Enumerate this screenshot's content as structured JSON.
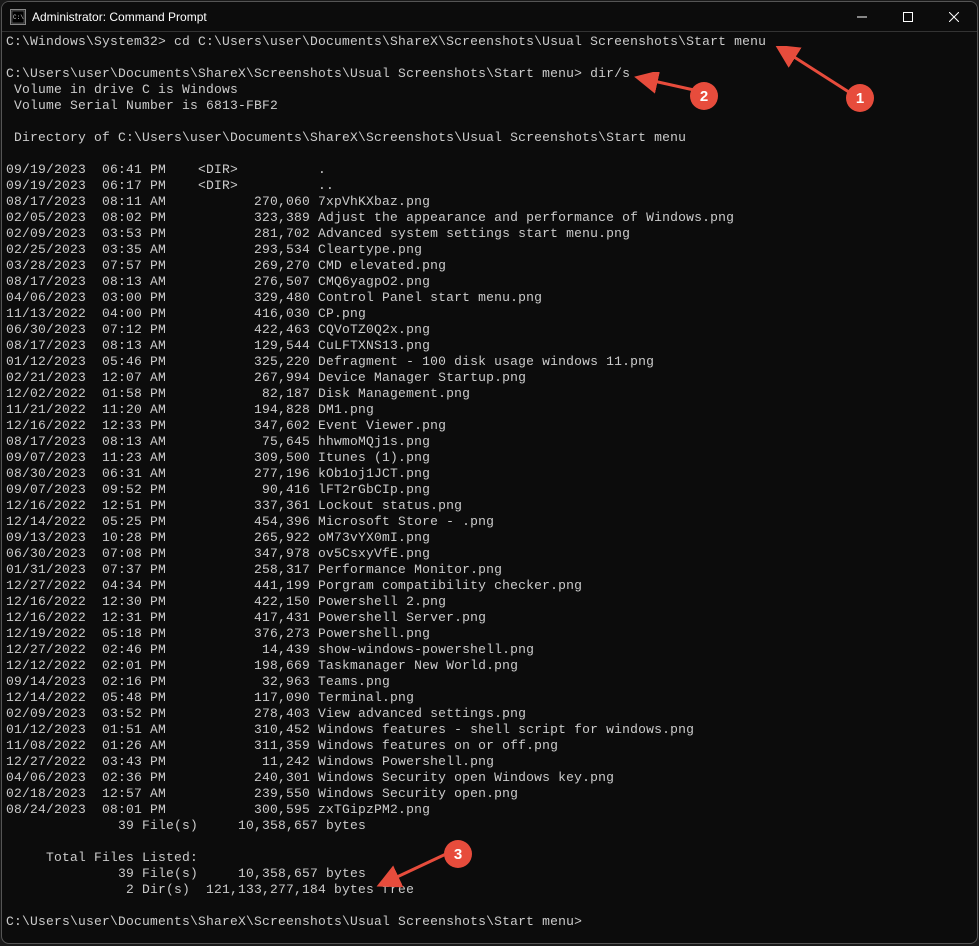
{
  "window": {
    "title": "Administrator: Command Prompt",
    "icon_glyph": "C:\\"
  },
  "prompt1": "C:\\Windows\\System32>",
  "command1": "cd C:\\Users\\user\\Documents\\ShareX\\Screenshots\\Usual Screenshots\\Start menu",
  "prompt2": "C:\\Users\\user\\Documents\\ShareX\\Screenshots\\Usual Screenshots\\Start menu>",
  "command2": "dir/s",
  "volume_line1": " Volume in drive C is Windows",
  "volume_line2": " Volume Serial Number is 6813-FBF2",
  "dir_header": " Directory of C:\\Users\\user\\Documents\\ShareX\\Screenshots\\Usual Screenshots\\Start menu",
  "entries": [
    {
      "date": "09/19/2023",
      "time": "06:41 PM",
      "size": "<DIR>         ",
      "name": "."
    },
    {
      "date": "09/19/2023",
      "time": "06:17 PM",
      "size": "<DIR>         ",
      "name": ".."
    },
    {
      "date": "08/17/2023",
      "time": "08:11 AM",
      "size": "       270,060",
      "name": "7xpVhKXbaz.png"
    },
    {
      "date": "02/05/2023",
      "time": "08:02 PM",
      "size": "       323,389",
      "name": "Adjust the appearance and performance of Windows.png"
    },
    {
      "date": "02/09/2023",
      "time": "03:53 PM",
      "size": "       281,702",
      "name": "Advanced system settings start menu.png"
    },
    {
      "date": "02/25/2023",
      "time": "03:35 AM",
      "size": "       293,534",
      "name": "Cleartype.png"
    },
    {
      "date": "03/28/2023",
      "time": "07:57 PM",
      "size": "       269,270",
      "name": "CMD elevated.png"
    },
    {
      "date": "08/17/2023",
      "time": "08:13 AM",
      "size": "       276,507",
      "name": "CMQ6yagpO2.png"
    },
    {
      "date": "04/06/2023",
      "time": "03:00 PM",
      "size": "       329,480",
      "name": "Control Panel start menu.png"
    },
    {
      "date": "11/13/2022",
      "time": "04:00 PM",
      "size": "       416,030",
      "name": "CP.png"
    },
    {
      "date": "06/30/2023",
      "time": "07:12 PM",
      "size": "       422,463",
      "name": "CQVoTZ0Q2x.png"
    },
    {
      "date": "08/17/2023",
      "time": "08:13 AM",
      "size": "       129,544",
      "name": "CuLFTXNS13.png"
    },
    {
      "date": "01/12/2023",
      "time": "05:46 PM",
      "size": "       325,220",
      "name": "Defragment - 100 disk usage windows 11.png"
    },
    {
      "date": "02/21/2023",
      "time": "12:07 AM",
      "size": "       267,994",
      "name": "Device Manager Startup.png"
    },
    {
      "date": "12/02/2022",
      "time": "01:58 PM",
      "size": "        82,187",
      "name": "Disk Management.png"
    },
    {
      "date": "11/21/2022",
      "time": "11:20 AM",
      "size": "       194,828",
      "name": "DM1.png"
    },
    {
      "date": "12/16/2022",
      "time": "12:33 PM",
      "size": "       347,602",
      "name": "Event Viewer.png"
    },
    {
      "date": "08/17/2023",
      "time": "08:13 AM",
      "size": "        75,645",
      "name": "hhwmoMQj1s.png"
    },
    {
      "date": "09/07/2023",
      "time": "11:23 AM",
      "size": "       309,500",
      "name": "Itunes (1).png"
    },
    {
      "date": "08/30/2023",
      "time": "06:31 AM",
      "size": "       277,196",
      "name": "kOb1oj1JCT.png"
    },
    {
      "date": "09/07/2023",
      "time": "09:52 PM",
      "size": "        90,416",
      "name": "lFT2rGbCIp.png"
    },
    {
      "date": "12/16/2022",
      "time": "12:51 PM",
      "size": "       337,361",
      "name": "Lockout status.png"
    },
    {
      "date": "12/14/2022",
      "time": "05:25 PM",
      "size": "       454,396",
      "name": "Microsoft Store - .png"
    },
    {
      "date": "09/13/2023",
      "time": "10:28 PM",
      "size": "       265,922",
      "name": "oM73vYX0mI.png"
    },
    {
      "date": "06/30/2023",
      "time": "07:08 PM",
      "size": "       347,978",
      "name": "ov5CsxyVfE.png"
    },
    {
      "date": "01/31/2023",
      "time": "07:37 PM",
      "size": "       258,317",
      "name": "Performance Monitor.png"
    },
    {
      "date": "12/27/2022",
      "time": "04:34 PM",
      "size": "       441,199",
      "name": "Porgram compatibility checker.png"
    },
    {
      "date": "12/16/2022",
      "time": "12:30 PM",
      "size": "       422,150",
      "name": "Powershell 2.png"
    },
    {
      "date": "12/16/2022",
      "time": "12:31 PM",
      "size": "       417,431",
      "name": "Powershell Server.png"
    },
    {
      "date": "12/19/2022",
      "time": "05:18 PM",
      "size": "       376,273",
      "name": "Powershell.png"
    },
    {
      "date": "12/27/2022",
      "time": "02:46 PM",
      "size": "        14,439",
      "name": "show-windows-powershell.png"
    },
    {
      "date": "12/12/2022",
      "time": "02:01 PM",
      "size": "       198,669",
      "name": "Taskmanager New World.png"
    },
    {
      "date": "09/14/2023",
      "time": "02:16 PM",
      "size": "        32,963",
      "name": "Teams.png"
    },
    {
      "date": "12/14/2022",
      "time": "05:48 PM",
      "size": "       117,090",
      "name": "Terminal.png"
    },
    {
      "date": "02/09/2023",
      "time": "03:52 PM",
      "size": "       278,403",
      "name": "View advanced settings.png"
    },
    {
      "date": "01/12/2023",
      "time": "01:51 AM",
      "size": "       310,452",
      "name": "Windows features - shell script for windows.png"
    },
    {
      "date": "11/08/2022",
      "time": "01:26 AM",
      "size": "       311,359",
      "name": "Windows features on or off.png"
    },
    {
      "date": "12/27/2022",
      "time": "03:43 PM",
      "size": "        11,242",
      "name": "Windows Powershell.png"
    },
    {
      "date": "04/06/2023",
      "time": "02:36 PM",
      "size": "       240,301",
      "name": "Windows Security open Windows key.png"
    },
    {
      "date": "02/18/2023",
      "time": "12:57 AM",
      "size": "       239,550",
      "name": "Windows Security open.png"
    },
    {
      "date": "08/24/2023",
      "time": "08:01 PM",
      "size": "       300,595",
      "name": "zxTGipzPM2.png"
    }
  ],
  "summary1": "              39 File(s)     10,358,657 bytes",
  "total_header": "     Total Files Listed:",
  "total_files": "              39 File(s)     10,358,657 bytes",
  "total_dirs": "               2 Dir(s)  121,133,277,184 bytes free",
  "prompt3": "C:\\Users\\user\\Documents\\ShareX\\Screenshots\\Usual Screenshots\\Start menu>",
  "annotations": {
    "a1": "1",
    "a2": "2",
    "a3": "3"
  }
}
